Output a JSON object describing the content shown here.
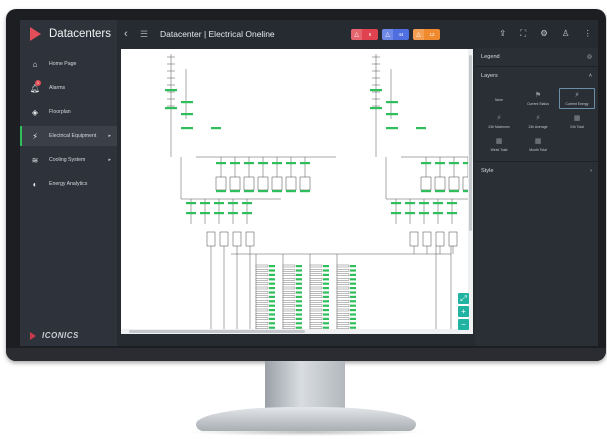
{
  "app": {
    "title": "Datacenters"
  },
  "nav": {
    "items": [
      {
        "label": "Home Page",
        "icon": "home-icon",
        "glyph": "⌂",
        "active": false,
        "has_arrow": false,
        "badge": ""
      },
      {
        "label": "Alarms",
        "icon": "bell-icon",
        "glyph": "🔔︎",
        "active": false,
        "has_arrow": false,
        "badge": "1"
      },
      {
        "label": "Floorplan",
        "icon": "layers-icon",
        "glyph": "◈",
        "active": false,
        "has_arrow": false,
        "badge": ""
      },
      {
        "label": "Electrical Equipment",
        "icon": "bolt-icon",
        "glyph": "⚡︎",
        "active": true,
        "has_arrow": true,
        "badge": ""
      },
      {
        "label": "Cooling System",
        "icon": "fan-icon",
        "glyph": "≋",
        "active": false,
        "has_arrow": true,
        "badge": ""
      },
      {
        "label": "Energy Analytics",
        "icon": "shield-icon",
        "glyph": "◐",
        "active": false,
        "has_arrow": false,
        "badge": ""
      }
    ]
  },
  "footer": {
    "logo_text": "ICONICS"
  },
  "header": {
    "title": "Datacenter | Electrical Oneline",
    "badges": [
      {
        "name": "critical-alarm-count",
        "value": "5",
        "color": "#e0434f",
        "glyph": "△"
      },
      {
        "name": "info-alarm-count",
        "value": "44",
        "color": "#4f6ee0",
        "glyph": "△"
      },
      {
        "name": "warning-alarm-count",
        "value": "12",
        "color": "#f08a2e",
        "glyph": "△"
      }
    ],
    "icons": [
      "share-icon",
      "fullscreen-icon",
      "settings-icon",
      "user-icon",
      "more-icon"
    ]
  },
  "panel": {
    "legend_label": "Legend",
    "layers_label": "Layers",
    "style_label": "Style",
    "layers": [
      {
        "label": "None",
        "glyph": "",
        "selected": false
      },
      {
        "label": "Current Status",
        "glyph": "⚑",
        "selected": false
      },
      {
        "label": "Current Energy",
        "glyph": "⚡︎",
        "selected": true
      },
      {
        "label": "24h Maximum",
        "glyph": "⚡︎",
        "selected": false
      },
      {
        "label": "24h Average",
        "glyph": "⚡︎",
        "selected": false
      },
      {
        "label": "24h Total",
        "glyph": "▦",
        "selected": false
      },
      {
        "label": "Week Total",
        "glyph": "▦",
        "selected": false
      },
      {
        "label": "Month Total",
        "glyph": "▦",
        "selected": false
      }
    ]
  },
  "colors": {
    "accent_green": "#2fbf5a",
    "zoom_teal": "#21b3a1",
    "brand_red": "#e24e5a"
  }
}
